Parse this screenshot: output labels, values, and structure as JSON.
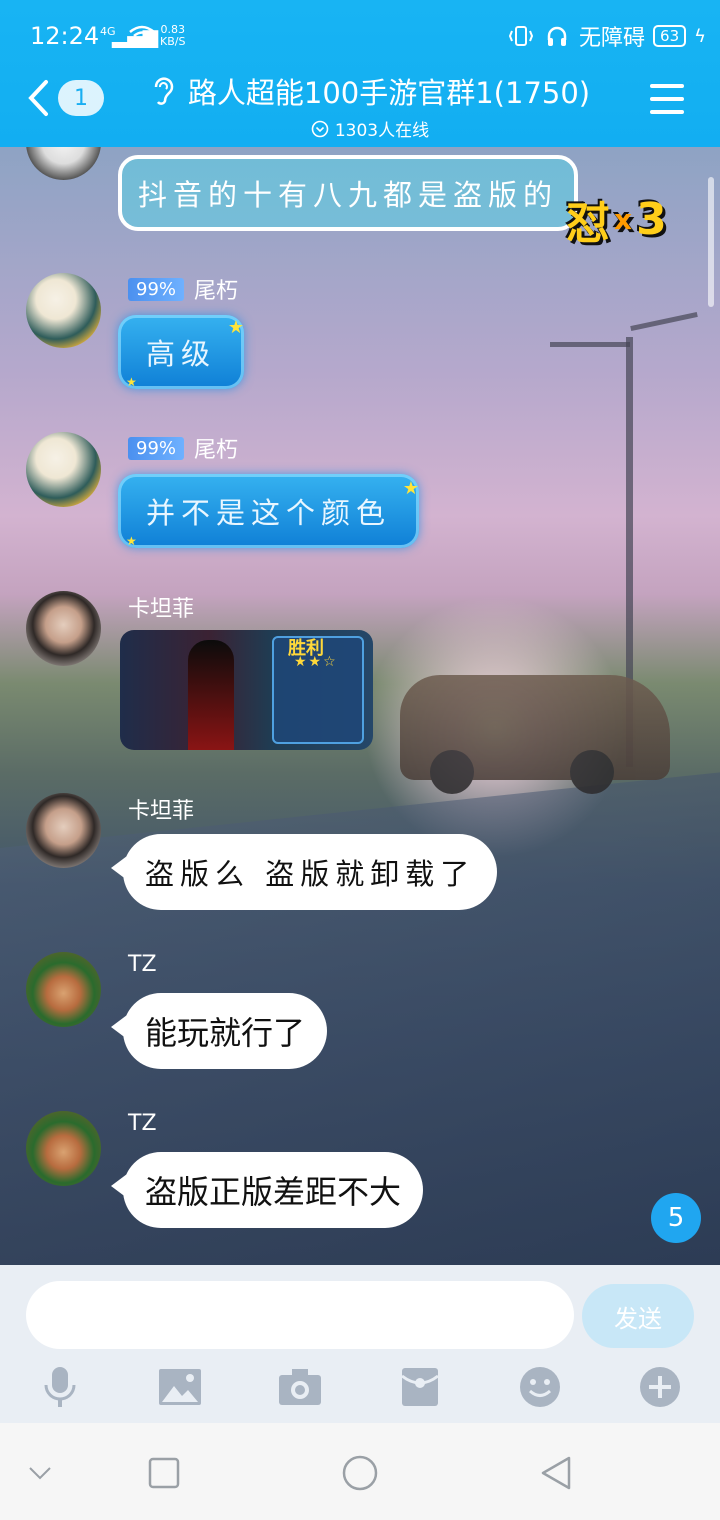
{
  "status_bar": {
    "time": "12:24",
    "network": "4G",
    "speed_value": "0.83",
    "speed_unit": "KB/S",
    "accessibility": "无障碍",
    "battery": "63"
  },
  "header": {
    "back_unread": "1",
    "title": "路人超能100手游官群1(1750)",
    "online": "1303人在线"
  },
  "messages": {
    "m0": {
      "text": "抖音的十有八九都是盗版的",
      "sticker_label": "怼",
      "sticker_x": "x",
      "sticker_count": "3"
    },
    "m1": {
      "level": "99%",
      "sender": "尾朽",
      "text": "高级"
    },
    "m2": {
      "level": "99%",
      "sender": "尾朽",
      "text": "并不是这个颜色"
    },
    "m3": {
      "sender": "卡坦菲",
      "image_label": "胜利"
    },
    "m4": {
      "sender": "卡坦菲",
      "text": "盗版么 盗版就卸载了"
    },
    "m5": {
      "sender": "TZ",
      "text": "能玩就行了"
    },
    "m6": {
      "sender": "TZ",
      "text": "盗版正版差距不大"
    }
  },
  "new_messages_badge": "5",
  "composer": {
    "input_value": "",
    "input_placeholder": "",
    "send_label": "发送"
  },
  "toolbar_icons": [
    "microphone-icon",
    "image-icon",
    "camera-icon",
    "red-packet-icon",
    "emoji-icon",
    "plus-icon"
  ],
  "colors": {
    "header": "#18b4f3",
    "bubble_blue": "#0f7fd6",
    "badge": "#20a6f0"
  }
}
